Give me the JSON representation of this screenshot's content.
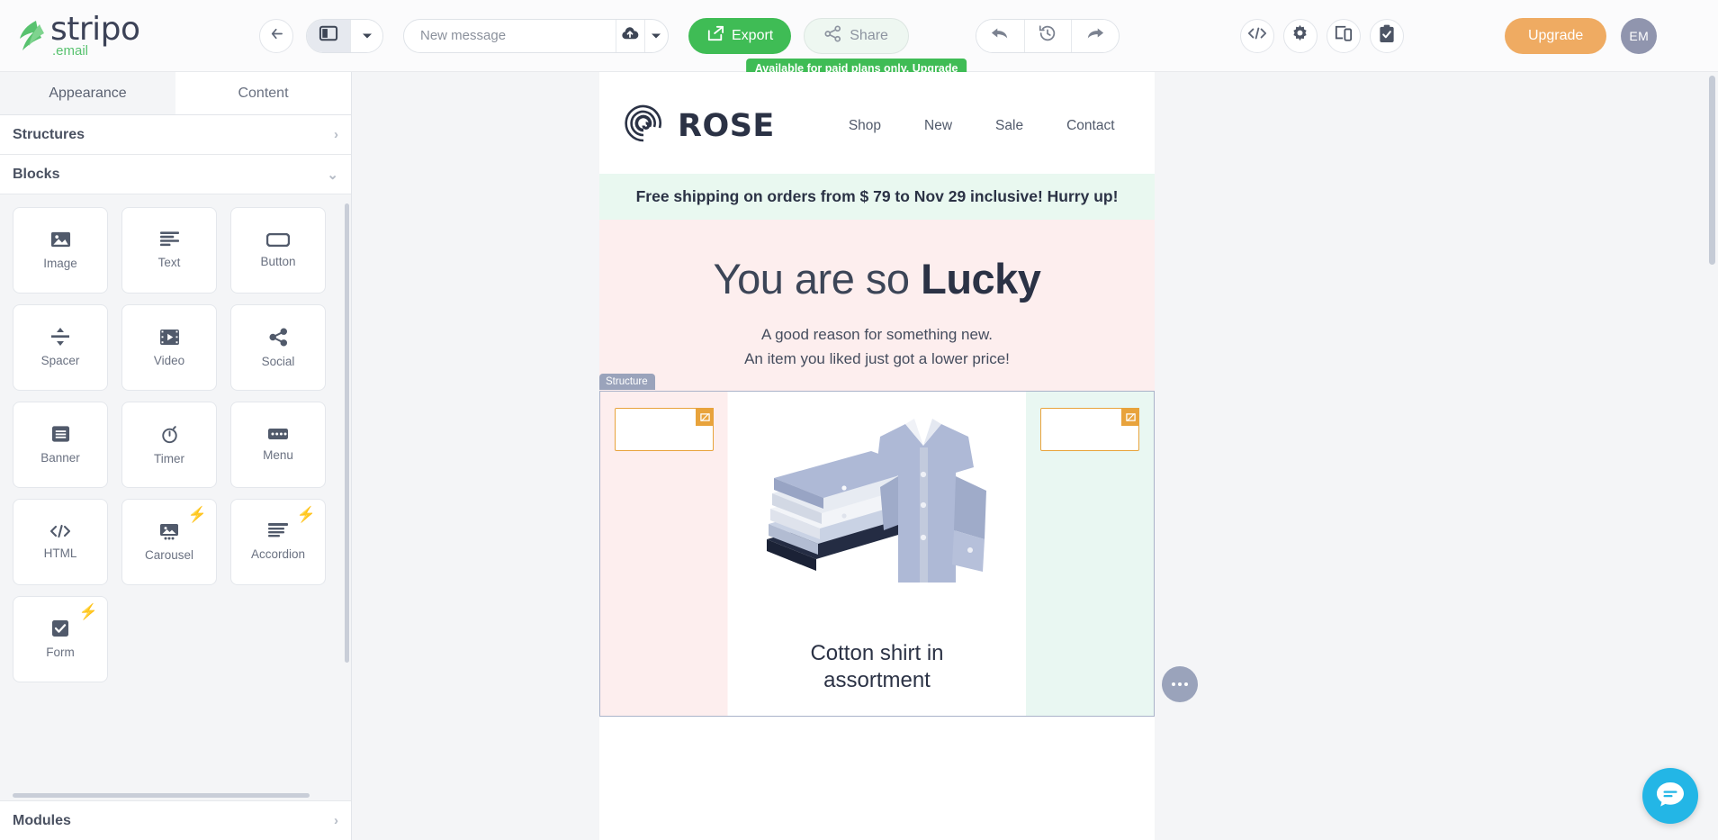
{
  "app": {
    "logo_name": "stripo",
    "logo_sub": ".email"
  },
  "toolbar": {
    "back_icon": "arrow-left-icon",
    "panel_icon": "layout-panel-icon",
    "panel_caret": "▾",
    "message_name": "",
    "message_placeholder": "New message",
    "upload_icon": "cloud-upload-icon",
    "upload_caret": "▾",
    "export_label": "Export",
    "export_icon": "export-icon",
    "share_label": "Share",
    "share_icon": "share-nodes-icon",
    "share_tooltip": "Available for paid plans only.",
    "share_tooltip_link": "Upgrade",
    "undo_icon": "undo-arrow-icon",
    "history_icon": "history-clock-icon",
    "redo_icon": "redo-arrow-icon",
    "code_icon": "code-brackets-icon",
    "settings_icon": "gear-icon",
    "device_icon": "device-preview-icon",
    "checklist_icon": "clipboard-check-icon",
    "upgrade_label": "Upgrade",
    "avatar_initials": "EM"
  },
  "sidebar": {
    "tabs": [
      {
        "label": "Appearance",
        "active": true
      },
      {
        "label": "Content",
        "active": false
      }
    ],
    "sections": [
      {
        "label": "Structures",
        "expanded": false
      },
      {
        "label": "Blocks",
        "expanded": true
      },
      {
        "label": "Modules",
        "expanded": false
      }
    ],
    "blocks": [
      {
        "label": "Image",
        "icon": "image-icon",
        "pro": false
      },
      {
        "label": "Text",
        "icon": "text-lines-icon",
        "pro": false
      },
      {
        "label": "Button",
        "icon": "button-icon",
        "pro": false
      },
      {
        "label": "Spacer",
        "icon": "spacer-icon",
        "pro": false
      },
      {
        "label": "Video",
        "icon": "video-icon",
        "pro": false
      },
      {
        "label": "Social",
        "icon": "share-nodes-icon",
        "pro": false
      },
      {
        "label": "Banner",
        "icon": "banner-icon",
        "pro": false
      },
      {
        "label": "Timer",
        "icon": "timer-icon",
        "pro": false
      },
      {
        "label": "Menu",
        "icon": "menu-icon",
        "pro": false
      },
      {
        "label": "HTML",
        "icon": "code-brackets-icon",
        "pro": false
      },
      {
        "label": "Carousel",
        "icon": "carousel-icon",
        "pro": true
      },
      {
        "label": "Accordion",
        "icon": "accordion-icon",
        "pro": true
      },
      {
        "label": "Form",
        "icon": "checkbox-icon",
        "pro": true
      }
    ],
    "pro_badge": "⚡"
  },
  "email": {
    "brand_name": "ROSE",
    "brand_logo_icon": "rose-spiral-icon",
    "nav": [
      "Shop",
      "New",
      "Sale",
      "Contact"
    ],
    "shipping_banner": "Free shipping on orders from $ 79 to Nov 29 inclusive! Hurry up!",
    "hero_title_normal": "You are so ",
    "hero_title_bold": "Lucky",
    "hero_sub_line1": "A good reason for something new.",
    "hero_sub_line2": "An item you liked just got a lower price!",
    "structure_tag": "Structure",
    "placeholder_badge_icon": "image-placeholder-icon",
    "product_title_line1": "Cotton shirt in",
    "product_title_line2": "assortment",
    "product_image_alt": "stack-of-folded-shirts"
  },
  "canvas": {
    "context_menu_icon": "ellipsis-icon",
    "chat_icon": "chat-bubble-icon"
  },
  "colors": {
    "brand_green": "#3fbc55",
    "upgrade_orange": "#efab62",
    "structure_blue": "#9aa3bb",
    "placeholder_orange": "#e8a33c",
    "hero_pink": "#fdeeee",
    "banner_mint": "#e9f8f0",
    "chat_blue": "#23b6e6"
  }
}
